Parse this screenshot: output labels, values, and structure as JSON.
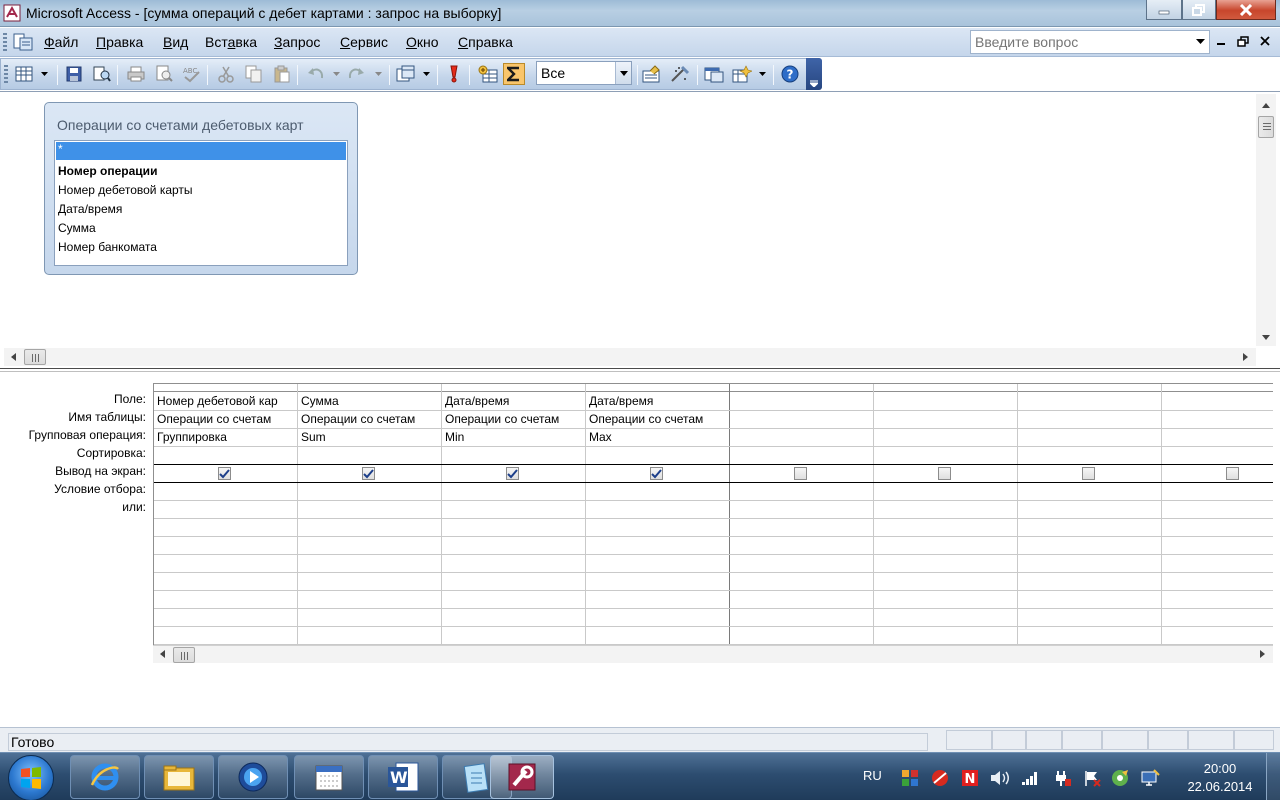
{
  "window": {
    "title": "Microsoft Access - [сумма операций с дебет картами : запрос на выборку]"
  },
  "menu": {
    "items": [
      {
        "label": "Файл",
        "key": "Ф",
        "rest": "айл"
      },
      {
        "label": "Правка",
        "key": "П",
        "rest": "равка"
      },
      {
        "label": "Вид",
        "key": "В",
        "rest": "ид"
      },
      {
        "label": "Вставка",
        "key": "а",
        "pre": "Вст",
        "rest": "вка"
      },
      {
        "label": "Запрос",
        "key": "З",
        "rest": "апрос"
      },
      {
        "label": "Сервис",
        "key": "С",
        "rest": "ервис"
      },
      {
        "label": "Окно",
        "key": "О",
        "rest": "кно"
      },
      {
        "label": "Справка",
        "key": "С",
        "rest": "правка"
      }
    ],
    "ask_placeholder": "Введите вопрос"
  },
  "toolbar": {
    "top_values": "Все",
    "totals_pressed": true,
    "icons": [
      "view-icon",
      "save-icon",
      "search-icon",
      "print-icon",
      "print-preview-icon",
      "spelling-icon",
      "cut-icon",
      "copy-icon",
      "paste-icon",
      "undo-icon",
      "redo-icon",
      "query-type-icon",
      "run-icon",
      "show-table-icon",
      "totals-icon",
      "properties-icon",
      "builder-icon",
      "database-window-icon",
      "new-object-icon",
      "help-icon"
    ]
  },
  "field_list": {
    "caption": "Операции со счетами дебетовых карт",
    "items": [
      {
        "label": "*",
        "selected": true
      },
      {
        "label": "Номер операции",
        "bold": true
      },
      {
        "label": "Номер дебетовой карты"
      },
      {
        "label": "Дата/время"
      },
      {
        "label": "Сумма"
      },
      {
        "label": "Номер банкомата"
      }
    ]
  },
  "grid": {
    "row_labels": [
      "Поле:",
      "Имя таблицы:",
      "Групповая операция:",
      "Сортировка:",
      "Вывод на экран:",
      "Условие отбора:",
      "или:"
    ],
    "columns": [
      {
        "field": "Номер дебетовой кар",
        "table": "Операции со счетам",
        "total": "Группировка",
        "sort": "",
        "show": true
      },
      {
        "field": "Сумма",
        "table": "Операции со счетам",
        "total": "Sum",
        "sort": "",
        "show": true
      },
      {
        "field": "Дата/время",
        "table": "Операции со счетам",
        "total": "Min",
        "sort": "",
        "show": true
      },
      {
        "field": "Дата/время",
        "table": "Операции со счетам",
        "total": "Max",
        "sort": "",
        "show": true
      },
      {
        "field": "",
        "table": "",
        "total": "",
        "sort": "",
        "show": false
      },
      {
        "field": "",
        "table": "",
        "total": "",
        "sort": "",
        "show": false
      },
      {
        "field": "",
        "table": "",
        "total": "",
        "sort": "",
        "show": false
      },
      {
        "field": "",
        "table": "",
        "total": "",
        "sort": "",
        "show": false
      }
    ]
  },
  "status": {
    "text": "Готово"
  },
  "taskbar": {
    "language": "RU",
    "time": "20:00",
    "date": "22.06.2014",
    "apps": [
      "internet-explorer-icon",
      "explorer-folder-icon",
      "media-player-icon",
      "calendar-app-icon",
      "word-icon",
      "notepad-icon",
      "access-icon"
    ]
  },
  "colors": {
    "selection": "#3f91e8",
    "totals_button": "#f9c56b",
    "title_bar": "#b8cfe3"
  }
}
